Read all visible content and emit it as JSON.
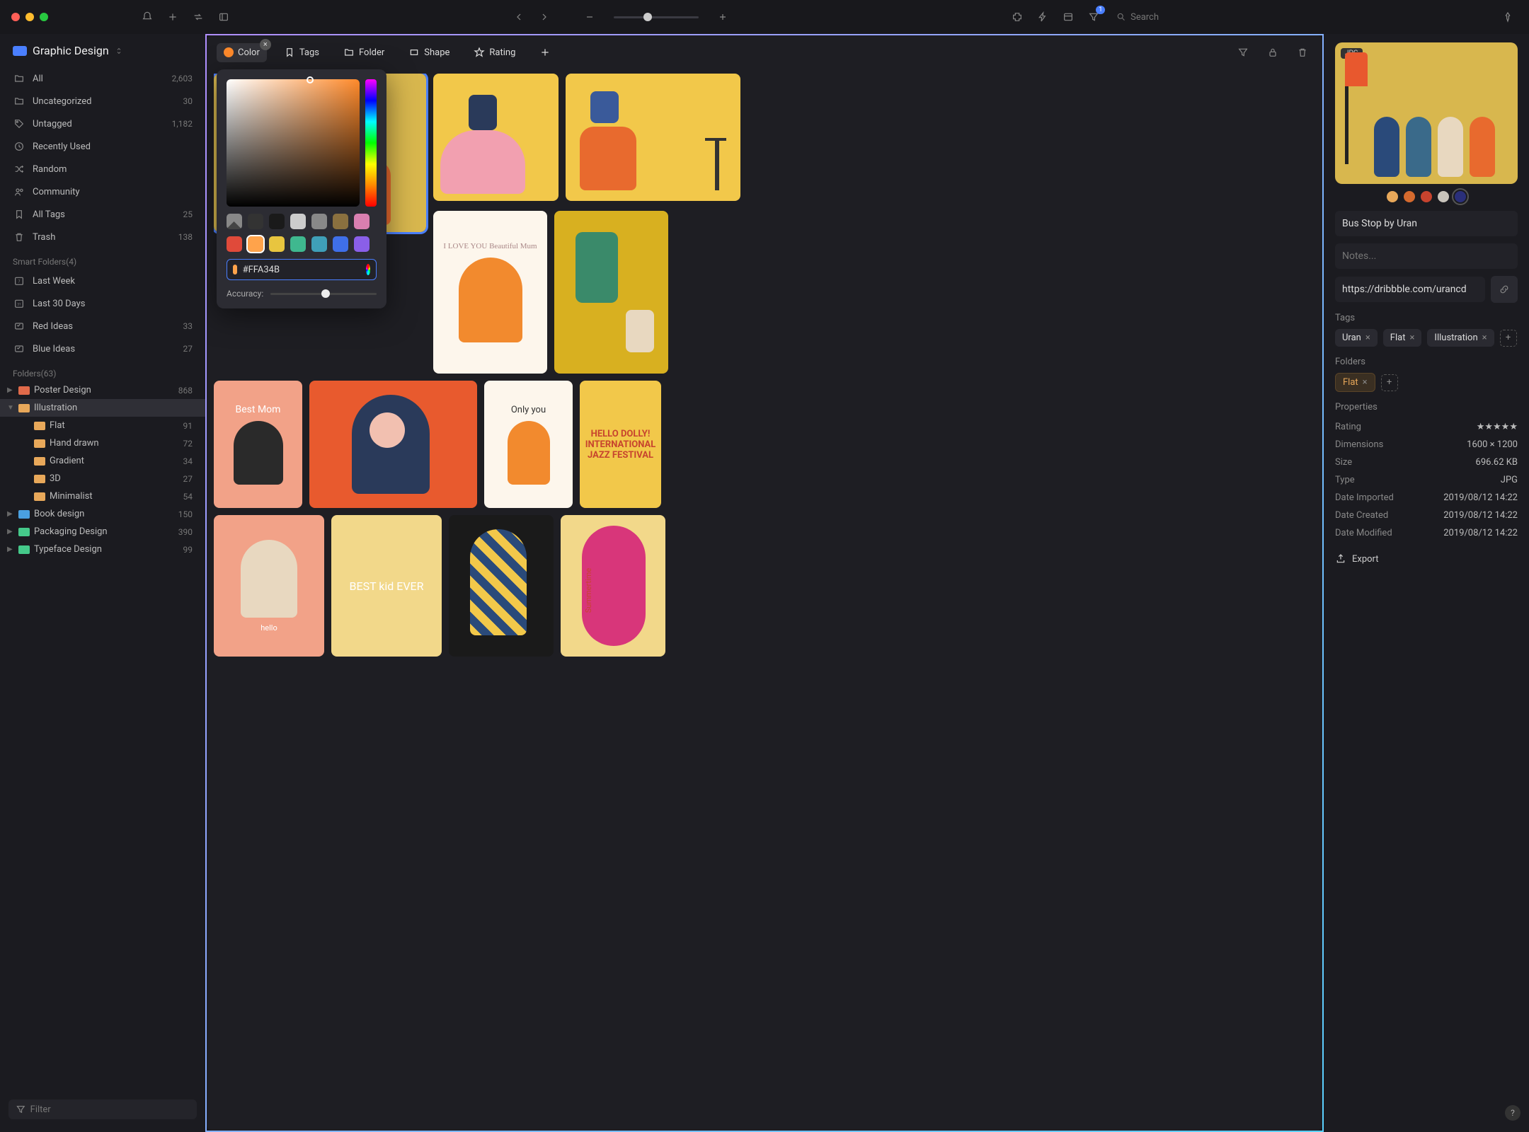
{
  "titlebar": {
    "search_placeholder": "Search",
    "filter_count": "1"
  },
  "library": {
    "name": "Graphic Design"
  },
  "sidebar": {
    "items": [
      {
        "label": "All",
        "count": "2,603",
        "icon": "folder-icon"
      },
      {
        "label": "Uncategorized",
        "count": "30",
        "icon": "folder-icon"
      },
      {
        "label": "Untagged",
        "count": "1,182",
        "icon": "tag-icon"
      },
      {
        "label": "Recently Used",
        "count": "",
        "icon": "clock-icon"
      },
      {
        "label": "Random",
        "count": "",
        "icon": "shuffle-icon"
      },
      {
        "label": "Community",
        "count": "",
        "icon": "people-icon"
      },
      {
        "label": "All Tags",
        "count": "25",
        "icon": "bookmark-icon"
      },
      {
        "label": "Trash",
        "count": "138",
        "icon": "trash-icon"
      }
    ],
    "smart_label": "Smart Folders(4)",
    "smart": [
      {
        "label": "Last Week",
        "count": "",
        "icon": "cal7-icon"
      },
      {
        "label": "Last 30 Days",
        "count": "",
        "icon": "cal31-icon"
      },
      {
        "label": "Red Ideas",
        "count": "33",
        "icon": "smart-icon"
      },
      {
        "label": "Blue Ideas",
        "count": "27",
        "icon": "smart-icon"
      }
    ],
    "folders_label": "Folders(63)",
    "folders": [
      {
        "label": "Poster Design",
        "count": "868",
        "color": "#e06a4a",
        "caret": "▶",
        "depth": 0
      },
      {
        "label": "Illustration",
        "count": "",
        "color": "#e8a85a",
        "caret": "▼",
        "depth": 0,
        "sel": true
      },
      {
        "label": "Flat",
        "count": "91",
        "color": "#e8a85a",
        "caret": "",
        "depth": 1
      },
      {
        "label": "Hand drawn",
        "count": "72",
        "color": "#e8a85a",
        "caret": "",
        "depth": 1
      },
      {
        "label": "Gradient",
        "count": "34",
        "color": "#e8a85a",
        "caret": "",
        "depth": 1
      },
      {
        "label": "3D",
        "count": "27",
        "color": "#e8a85a",
        "caret": "",
        "depth": 1
      },
      {
        "label": "Minimalist",
        "count": "54",
        "color": "#e8a85a",
        "caret": "",
        "depth": 1
      },
      {
        "label": "Book design",
        "count": "150",
        "color": "#4aa0e0",
        "caret": "▶",
        "depth": 0
      },
      {
        "label": "Packaging Design",
        "count": "390",
        "color": "#45c98a",
        "caret": "▶",
        "depth": 0
      },
      {
        "label": "Typeface Design",
        "count": "99",
        "color": "#45c98a",
        "caret": "▶",
        "depth": 0
      }
    ],
    "filter_placeholder": "Filter"
  },
  "filterbar": {
    "color": "Color",
    "tags": "Tags",
    "folder": "Folder",
    "shape": "Shape",
    "rating": "Rating"
  },
  "color_popover": {
    "hex": "#FFA34B",
    "accuracy_label": "Accuracy:",
    "swatches1": [
      "#666666",
      "#333333",
      "#1a1a1a",
      "#cccccc",
      "#888888",
      "#8a703f",
      "#d97fb0"
    ],
    "swatches2": [
      "#e04a3a",
      "#ffa34b",
      "#e8c53f",
      "#3fb88f",
      "#3f9fb8",
      "#3f6fe8",
      "#8a5fe8"
    ]
  },
  "inspector": {
    "badge": "JPG",
    "title": "Bus Stop by Uran",
    "notes_placeholder": "Notes...",
    "url": "https://dribbble.com/urancd",
    "tags_label": "Tags",
    "tags": [
      "Uran",
      "Flat",
      "Illustration"
    ],
    "folders_label": "Folders",
    "folders": [
      "Flat"
    ],
    "properties_label": "Properties",
    "properties": [
      {
        "k": "Rating",
        "v": "★★★★★",
        "stars": true
      },
      {
        "k": "Dimensions",
        "v": "1600 × 1200"
      },
      {
        "k": "Size",
        "v": "696.62 KB"
      },
      {
        "k": "Type",
        "v": "JPG"
      },
      {
        "k": "Date Imported",
        "v": "2019/08/12 14:22"
      },
      {
        "k": "Date Created",
        "v": "2019/08/12 14:22"
      },
      {
        "k": "Date Modified",
        "v": "2019/08/12 14:22"
      }
    ],
    "export": "Export",
    "colors": [
      "#e8a85a",
      "#d56a2e",
      "#c7432e",
      "#c8c3bb",
      "#2a2f7a"
    ]
  },
  "gallery": {
    "cards": [
      {
        "text": "I LOVE YOU Beautiful Mum",
        "bg": "#fdf6ec"
      },
      {
        "text": "Best Mom",
        "bg": "#f2a288"
      },
      {
        "text": "Only you",
        "bg": "#fdf6ec"
      },
      {
        "text": "HELLO DOLLY! INTERNATIONAL JAZZ FESTIVAL",
        "bg": "#f2c84a"
      },
      {
        "text": "BEST kid EVER",
        "bg": "#f2d88a"
      },
      {
        "text": "hello",
        "bg": "#f2a288"
      },
      {
        "text": "Summertime",
        "bg": "#f2d88a"
      }
    ]
  }
}
